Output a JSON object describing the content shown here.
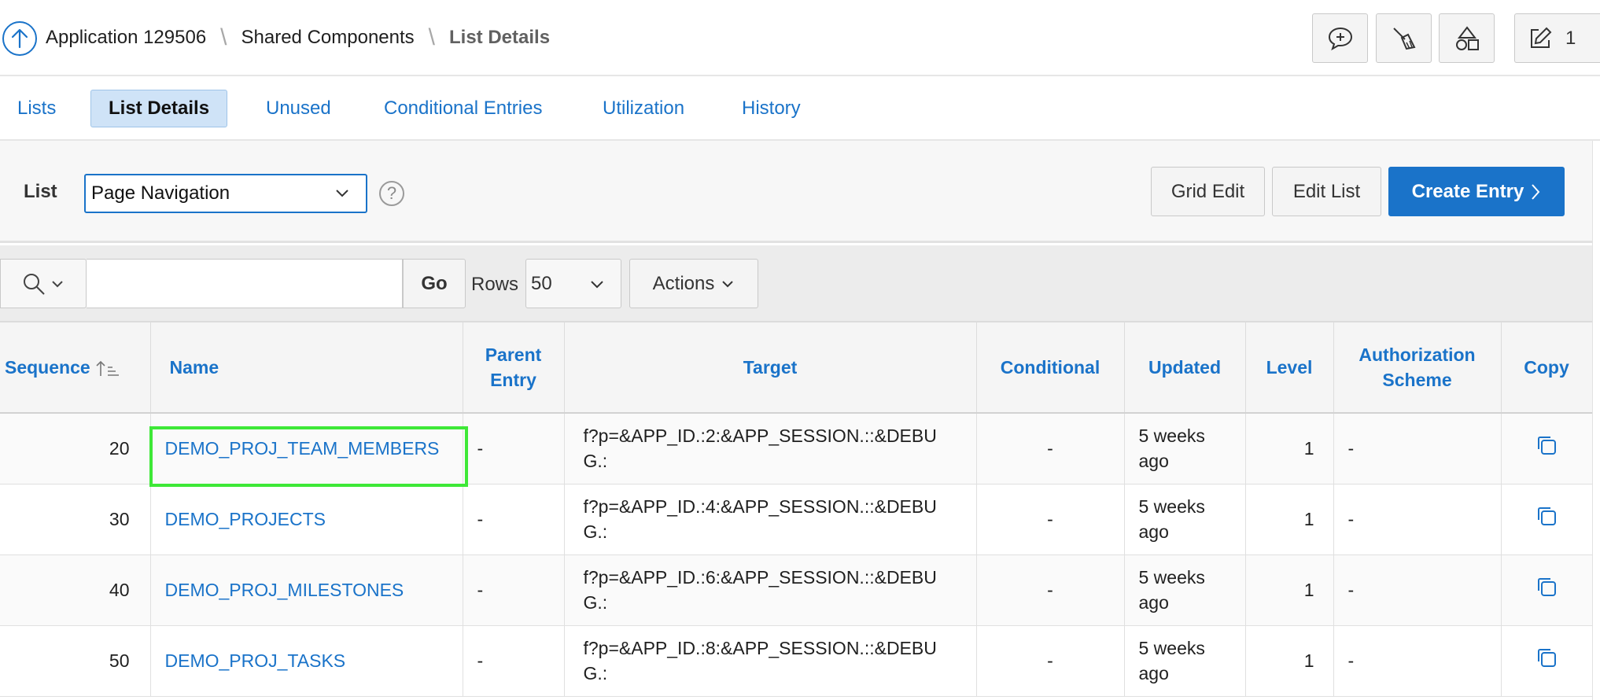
{
  "breadcrumb": {
    "items": [
      "Application 129506",
      "Shared Components",
      "List Details"
    ],
    "separator": "\\"
  },
  "toolbar": {
    "feedback_icon": "speech-bubble-plus-icon",
    "cleanup_icon": "broom-icon",
    "shapes_icon": "shapes-icon",
    "edit_icon": "pencil-square-icon",
    "edit_count": "1"
  },
  "tabs": [
    {
      "label": "Lists",
      "active": false
    },
    {
      "label": "List Details",
      "active": true
    },
    {
      "label": "Unused",
      "active": false
    },
    {
      "label": "Conditional Entries",
      "active": false
    },
    {
      "label": "Utilization",
      "active": false
    },
    {
      "label": "History",
      "active": false
    }
  ],
  "list_selector": {
    "label": "List",
    "value": "Page Navigation",
    "help": "?"
  },
  "buttons": {
    "grid_edit": "Grid Edit",
    "edit_list": "Edit List",
    "create_entry": "Create Entry"
  },
  "search": {
    "value": "",
    "go_label": "Go",
    "rows_label": "Rows",
    "rows_value": "50",
    "actions_label": "Actions"
  },
  "table": {
    "columns": {
      "sequence": "Sequence",
      "name": "Name",
      "parent_entry": "Parent Entry",
      "target": "Target",
      "conditional": "Conditional",
      "updated": "Updated",
      "level": "Level",
      "authorization_scheme": "Authorization Scheme",
      "copy": "Copy"
    },
    "sort": {
      "column": "Sequence",
      "direction": "ascending"
    },
    "rows": [
      {
        "sequence": "20",
        "name": "DEMO_PROJ_TEAM_MEMBERS",
        "parent_entry": "-",
        "target": "f?p=&APP_ID.:2:&APP_SESSION.::&DEBUG.:",
        "conditional": "-",
        "updated": "5 weeks ago",
        "level": "1",
        "authorization_scheme": "-"
      },
      {
        "sequence": "30",
        "name": "DEMO_PROJECTS",
        "parent_entry": "-",
        "target": "f?p=&APP_ID.:4:&APP_SESSION.::&DEBUG.:",
        "conditional": "-",
        "updated": "5 weeks ago",
        "level": "1",
        "authorization_scheme": "-"
      },
      {
        "sequence": "40",
        "name": "DEMO_PROJ_MILESTONES",
        "parent_entry": "-",
        "target": "f?p=&APP_ID.:6:&APP_SESSION.::&DEBUG.:",
        "conditional": "-",
        "updated": "5 weeks ago",
        "level": "1",
        "authorization_scheme": "-"
      },
      {
        "sequence": "50",
        "name": "DEMO_PROJ_TASKS",
        "parent_entry": "-",
        "target": "f?p=&APP_ID.:8:&APP_SESSION.::&DEBUG.:",
        "conditional": "-",
        "updated": "5 weeks ago",
        "level": "1",
        "authorization_scheme": "-"
      }
    ]
  },
  "colors": {
    "accent": "#1a73c9",
    "active_tab_bg": "#cfe3f7",
    "highlight": "#3ee837"
  }
}
